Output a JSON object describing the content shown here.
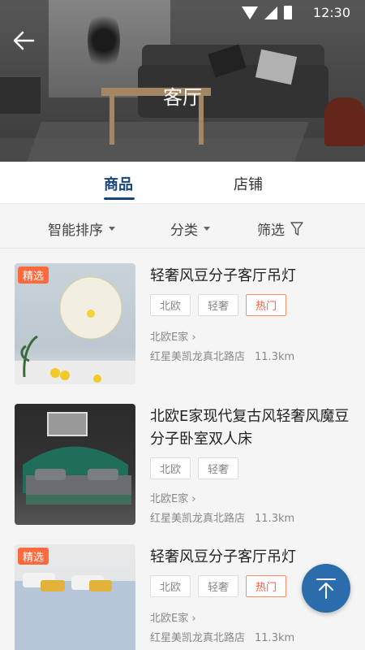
{
  "status_bar": {
    "time": "12:30"
  },
  "header": {
    "title": "客厅"
  },
  "tabs": [
    {
      "label": "商品"
    },
    {
      "label": "店铺"
    }
  ],
  "filters": [
    {
      "label": "智能排序"
    },
    {
      "label": "分类"
    },
    {
      "label": "筛选"
    }
  ],
  "products": [
    {
      "badge": "精选",
      "title": "轻奢风豆分子客厅吊灯",
      "tags": [
        "北欧",
        "轻奢"
      ],
      "hot_tag": "热门",
      "store": "北欧E家",
      "address": "红星美凯龙真北路店",
      "distance": "11.3km"
    },
    {
      "badge": "",
      "title": "北欧E家现代复古风轻奢风魔豆分子卧室双人床",
      "tags": [
        "北欧",
        "轻奢"
      ],
      "hot_tag": "",
      "store": "北欧E家",
      "address": "红星美凯龙真北路店",
      "distance": "11.3km"
    },
    {
      "badge": "精选",
      "title": "轻奢风豆分子客厅吊灯",
      "tags": [
        "北欧",
        "轻奢"
      ],
      "hot_tag": "热门",
      "store": "北欧E家",
      "address": "红星美凯龙真北路店",
      "distance": "11.3km"
    }
  ],
  "colors": {
    "accent": "#16457a",
    "badge": "#ff6a3d",
    "hot": "#ff5a3c",
    "fab": "#2b6cad"
  },
  "icons": {
    "back": "arrow-left-icon",
    "filter": "funnel-icon",
    "top": "arrow-up-icon"
  }
}
